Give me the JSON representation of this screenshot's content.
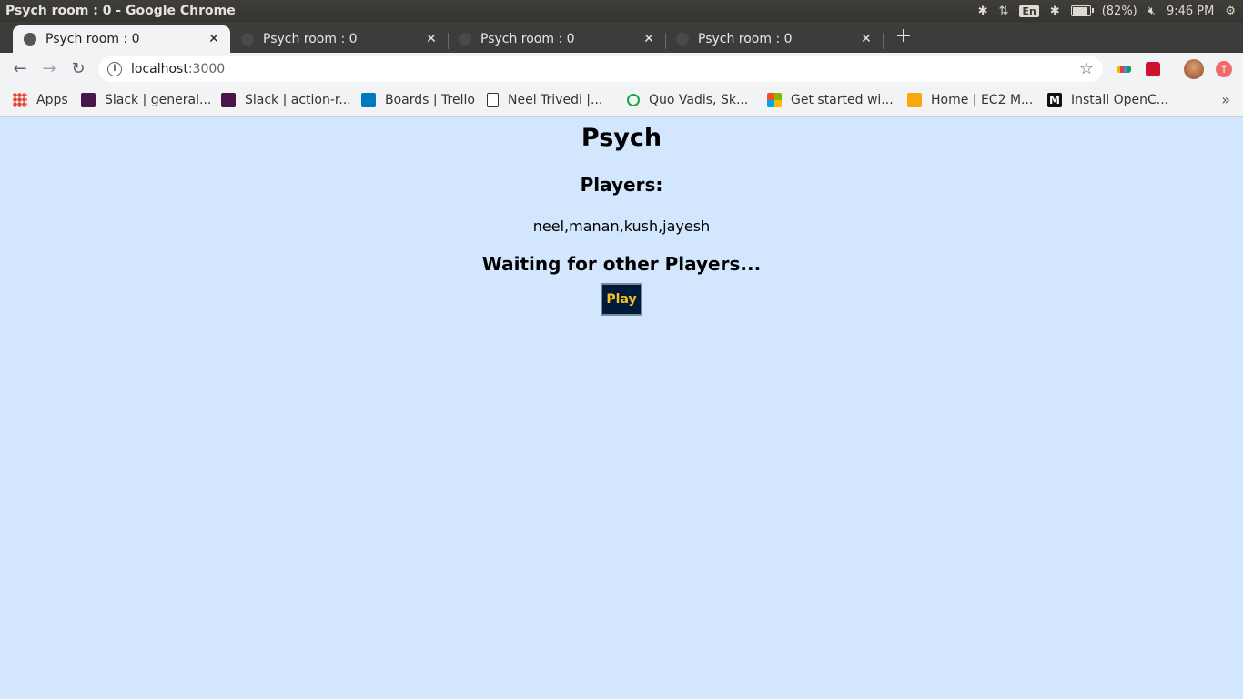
{
  "window": {
    "title": "Psych room : 0 - Google Chrome"
  },
  "system_tray": {
    "language": "En",
    "battery": "(82%)",
    "time": "9:46 PM"
  },
  "tabs": [
    {
      "label": "Psych room : 0",
      "active": true
    },
    {
      "label": "Psych room : 0",
      "active": false
    },
    {
      "label": "Psych room : 0",
      "active": false
    },
    {
      "label": "Psych room : 0",
      "active": false
    }
  ],
  "address_bar": {
    "host": "localhost",
    "port": ":3000"
  },
  "bookmarks": [
    {
      "label": "Apps",
      "icon": "apps-grid-icon"
    },
    {
      "label": "Slack | general...",
      "icon": "slack-icon"
    },
    {
      "label": "Slack | action-r...",
      "icon": "slack-icon"
    },
    {
      "label": "Boards | Trello",
      "icon": "trello-icon"
    },
    {
      "label": "Neel Trivedi |...",
      "icon": "page-icon"
    },
    {
      "label": "Quo Vadis, Sk...",
      "icon": "leaf-icon"
    },
    {
      "label": "Get started wi...",
      "icon": "microsoft-icon"
    },
    {
      "label": "Home | EC2 M...",
      "icon": "aws-box-icon"
    },
    {
      "label": "Install OpenC...",
      "icon": "medium-icon"
    }
  ],
  "page": {
    "title": "Psych",
    "players_heading": "Players:",
    "players_list": "neel,manan,kush,jayesh",
    "status": "Waiting for other Players...",
    "play_button": "Play"
  }
}
